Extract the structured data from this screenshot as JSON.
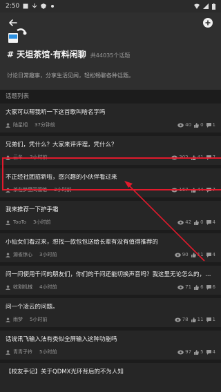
{
  "status_bar": {
    "time": "2:50"
  },
  "header": {
    "topic_title": "# 天坦茶馆·有料闲聊",
    "topic_count": "共44035个话题",
    "description": "讨论日常趣事，分享生活见闻，轻松畅聊各种话题。"
  },
  "section_label": "话题列表",
  "topics": [
    {
      "title": "大家可以帮我听一下这首歌叫啥名字吗",
      "author": "陆星相",
      "time": "37分钟前",
      "views": "40",
      "likes": "0",
      "comments": "1"
    },
    {
      "title": "兄弟们，凭什么？大家来评评理，凭什么？",
      "author": "云牟",
      "time": "3小时前",
      "views": "302",
      "likes": "41",
      "comments": "7"
    },
    {
      "title": "不正经社团招新啦，感兴趣的小伙伴看过来",
      "author": "茶在梦里同福馆",
      "time": "3小时前",
      "views": "167",
      "likes": "44",
      "comments": "7"
    },
    {
      "title": "我来推荐一下护手霜",
      "author": "TooTo",
      "time": "3小时前",
      "views": "42",
      "likes": "0",
      "comments": "4"
    },
    {
      "title": "小仙女们看过来，想找一款包包送给长辈有没有值得推荐的",
      "author": "源雀惊心",
      "time": "3小时前",
      "views": "90",
      "likes": "11",
      "comments": "4"
    },
    {
      "title": "问一问使用千问的朋友们，你们的千问还能切换声音吗？我这里无论怎么的，似乎都",
      "author": "收割机械",
      "time": "4小时前",
      "views": "71",
      "likes": "6",
      "comments": "6"
    },
    {
      "title": "问一个凌云的问题。",
      "author": "雨梦",
      "time": "5小时前",
      "views": "78",
      "likes": "11",
      "comments": "1"
    },
    {
      "title": "话说讯飞输入法有类似全屏输入这种功能吗",
      "author": "青青子衿",
      "time": "5小时前",
      "views": "97",
      "likes": "5",
      "comments": "4"
    },
    {
      "title": "【校友手记】关于QDMX光环背后的不为人知",
      "author": "",
      "time": "",
      "views": "",
      "likes": "",
      "comments": ""
    }
  ],
  "icons": {
    "back": "arrow-left-icon",
    "add": "plus-circle-icon",
    "topic": "teacup-icon",
    "views": "eye-icon",
    "likes": "thumbs-up-icon",
    "comments": "comment-icon"
  },
  "colors": {
    "highlight": "#e21a2c",
    "background": "#1c1c1c",
    "card": "#262626"
  }
}
